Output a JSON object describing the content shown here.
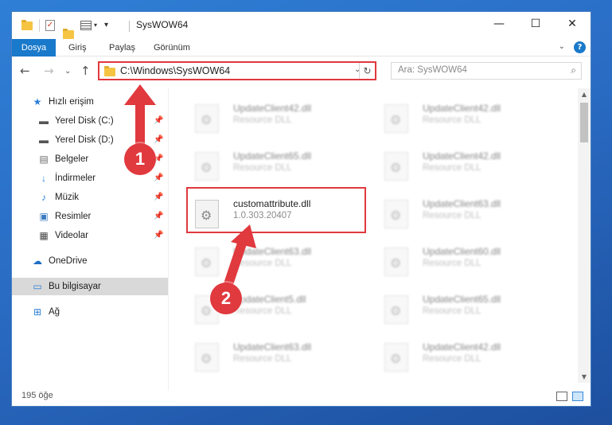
{
  "window": {
    "title": "SysWOW64",
    "controls": {
      "minimize": "—",
      "maximize": "☐",
      "close": "✕"
    }
  },
  "ribbon": {
    "tabs": [
      "Dosya",
      "Giriş",
      "Paylaş",
      "Görünüm"
    ],
    "collapse_glyph": "⌄",
    "help_glyph": "?"
  },
  "address": {
    "path": "C:\\Windows\\SysWOW64",
    "dropdown_glyph": "⌄",
    "refresh_glyph": "↻"
  },
  "search": {
    "placeholder": "Ara: SysWOW64",
    "icon": "search-icon"
  },
  "nav": {
    "back": "←",
    "forward": "→",
    "recent": "⌄",
    "up": "↑"
  },
  "sidebar": {
    "items": [
      {
        "label": "Hızlı erişim",
        "icon": "star-icon",
        "pinned": false
      },
      {
        "label": "Yerel Disk (C:)",
        "icon": "drive-icon",
        "pinned": true
      },
      {
        "label": "Yerel Disk (D:)",
        "icon": "drive-icon",
        "pinned": true
      },
      {
        "label": "Belgeler",
        "icon": "documents-icon",
        "pinned": true
      },
      {
        "label": "İndirmeler",
        "icon": "download-icon",
        "pinned": true
      },
      {
        "label": "Müzik",
        "icon": "music-icon",
        "pinned": true
      },
      {
        "label": "Resimler",
        "icon": "pictures-icon",
        "pinned": true
      },
      {
        "label": "Videolar",
        "icon": "video-icon",
        "pinned": true
      },
      {
        "label": "OneDrive",
        "icon": "cloud-icon",
        "pinned": false
      },
      {
        "label": "Bu bilgisayar",
        "icon": "computer-icon",
        "pinned": false,
        "selected": true
      },
      {
        "label": "Ağ",
        "icon": "network-icon",
        "pinned": false
      }
    ]
  },
  "files": {
    "left_column": [
      {
        "name": "UpdateClient42.dll",
        "sub": "Resource DLL",
        "blurred": true
      },
      {
        "name": "UpdateClient65.dll",
        "sub": "Resource DLL",
        "blurred": true
      },
      {
        "name": "customattribute.dll",
        "sub": "1.0.303.20407",
        "blurred": false,
        "highlighted": true
      },
      {
        "name": "UpdateClient63.dll",
        "sub": "Resource DLL",
        "blurred": true
      },
      {
        "name": "UpdateClient5.dll",
        "sub": "Resource DLL",
        "blurred": true
      },
      {
        "name": "UpdateClient63.dll",
        "sub": "Resource DLL",
        "blurred": true
      }
    ],
    "right_column": [
      {
        "name": "UpdateClient42.dll",
        "sub": "Resource DLL",
        "blurred": true
      },
      {
        "name": "UpdateClient42.dll",
        "sub": "Resource DLL",
        "blurred": true
      },
      {
        "name": "UpdateClient63.dll",
        "sub": "Resource DLL",
        "blurred": true
      },
      {
        "name": "UpdateClient60.dll",
        "sub": "Resource DLL",
        "blurred": true
      },
      {
        "name": "UpdateClient65.dll",
        "sub": "Resource DLL",
        "blurred": true
      },
      {
        "name": "UpdateClient42.dll",
        "sub": "Resource DLL",
        "blurred": true
      }
    ]
  },
  "status": {
    "count_text": "195 öğe"
  },
  "annotations": {
    "step1": "1",
    "step2": "2",
    "color": "#e0393e"
  },
  "colors": {
    "accent": "#1979ca",
    "highlight": "#e0393e",
    "selected_nav": "#d9d9d9"
  }
}
